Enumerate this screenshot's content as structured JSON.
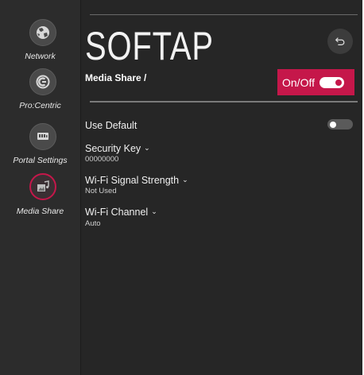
{
  "sidebar": {
    "items": [
      {
        "label": "Network",
        "icon": "network-globe-icon"
      },
      {
        "label": "Pro:Centric",
        "icon": "procentric-icon"
      },
      {
        "label": "Portal Settings",
        "icon": "portal-settings-icon"
      },
      {
        "label": "Media Share",
        "icon": "media-share-icon",
        "active": true
      }
    ]
  },
  "header": {
    "title": "SOFTAP",
    "breadcrumb": "Media Share /",
    "back_icon": "back-arrow-icon",
    "onoff_label": "On/Off",
    "onoff_state": true
  },
  "settings": {
    "use_default": {
      "label": "Use Default",
      "state": false
    },
    "security_key": {
      "label": "Security Key",
      "value": "00000000"
    },
    "wifi_signal_strength": {
      "label": "Wi-Fi Signal Strength",
      "value": "Not Used"
    },
    "wifi_channel": {
      "label": "Wi-Fi Channel",
      "value": "Auto"
    }
  },
  "colors": {
    "accent": "#c5174a",
    "background": "#262626",
    "sidebar": "#2c2c2c"
  }
}
